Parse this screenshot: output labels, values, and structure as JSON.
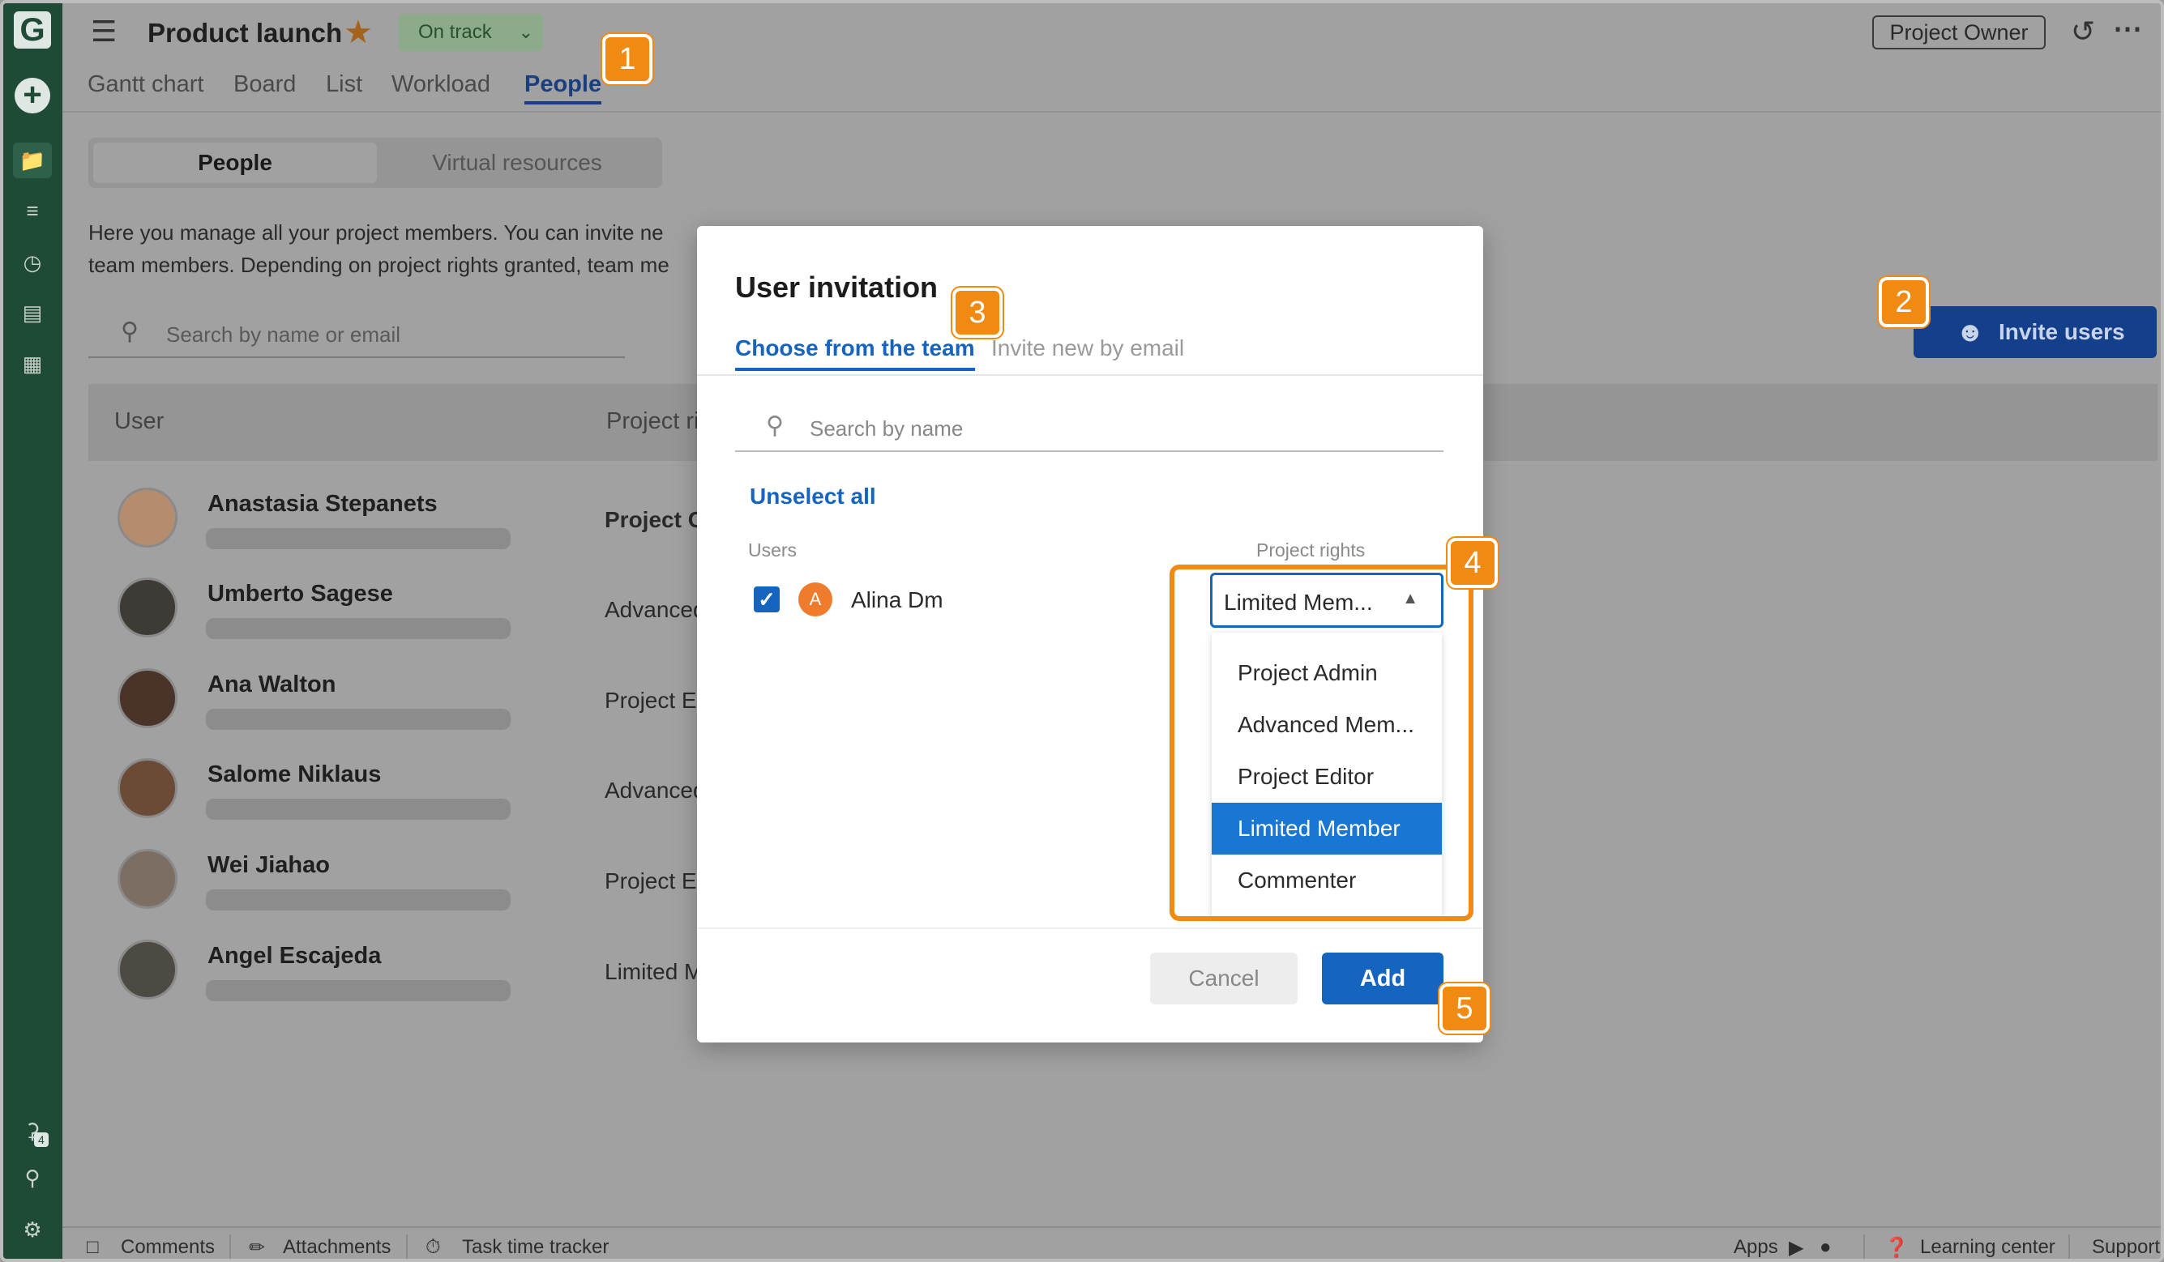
{
  "header": {
    "project_title": "Product launch",
    "status_label": "On track",
    "owner_label": "Project Owner",
    "tabs": [
      {
        "label": "Gantt chart"
      },
      {
        "label": "Board"
      },
      {
        "label": "List"
      },
      {
        "label": "Workload"
      },
      {
        "label": "People"
      }
    ]
  },
  "rail": {
    "logo_letter": "G",
    "notification_count": "4"
  },
  "main": {
    "segments": [
      {
        "label": "People"
      },
      {
        "label": "Virtual resources"
      }
    ],
    "description_line1": "Here you manage all your project members. You can invite ne",
    "description_line2": "team members. Depending on project rights granted, team me",
    "search_placeholder": "Search by name or email",
    "invite_button": "Invite users",
    "columns": [
      {
        "label": "User"
      },
      {
        "label": "Project ri"
      }
    ],
    "members": [
      {
        "name": "Anastasia Stepanets",
        "role": "Project C"
      },
      {
        "name": "Umberto Sagese",
        "role": "Advanced"
      },
      {
        "name": "Ana Walton",
        "role": "Project E"
      },
      {
        "name": "Salome Niklaus",
        "role": "Advanced"
      },
      {
        "name": "Wei Jiahao",
        "role": "Project E"
      },
      {
        "name": "Angel Escajeda",
        "role": "Limited M"
      }
    ]
  },
  "modal": {
    "title": "User invitation",
    "tab_active": "Choose from the team",
    "tab_inactive": "Invite new by email",
    "search_placeholder": "Search by name",
    "unselect_all": "Unselect all",
    "col_users": "Users",
    "col_rights": "Project rights",
    "user": {
      "initial": "A",
      "name": "Alina Dm",
      "checked": true
    },
    "selected_right": "Limited Mem...",
    "rights_options": [
      {
        "label": "Project Admin"
      },
      {
        "label": "Advanced Mem..."
      },
      {
        "label": "Project Editor"
      },
      {
        "label": "Limited Member"
      },
      {
        "label": "Commenter"
      }
    ],
    "cancel_label": "Cancel",
    "add_label": "Add"
  },
  "footer": {
    "comments": "Comments",
    "attachments": "Attachments",
    "task_time_tracker": "Task time tracker",
    "apps": "Apps",
    "learning_center": "Learning center",
    "support": "Support"
  },
  "callouts": [
    "1",
    "2",
    "3",
    "4",
    "5"
  ],
  "colors": {
    "rail": "#1f4a35",
    "accent_blue": "#1565c0",
    "callout_orange": "#f08a12",
    "selected_option": "#1976d2"
  }
}
